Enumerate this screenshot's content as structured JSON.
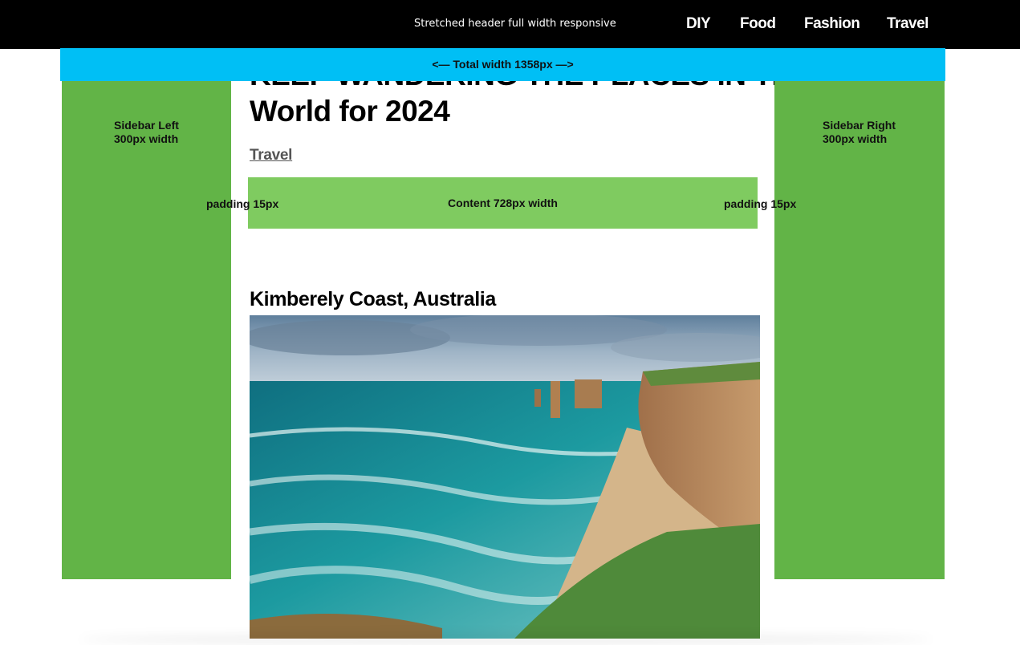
{
  "header": {
    "caption": "Stretched header full width responsive",
    "nav": [
      {
        "label": "DIY"
      },
      {
        "label": "Food"
      },
      {
        "label": "Fashion"
      },
      {
        "label": "Travel"
      }
    ],
    "background": "#000000"
  },
  "width_bar": {
    "label": "<— Total width 1358px —>",
    "color": "#00BFF5"
  },
  "sidebar_left": {
    "label": "Sidebar Left\n300px width",
    "color": "#62B447"
  },
  "sidebar_right": {
    "label": "Sidebar Right\n300px width",
    "color": "#62B447"
  },
  "article": {
    "title_partial": "KEEP WANDERING THE PLACES IN THE",
    "title": "World for 2024",
    "category": "Travel",
    "content_box_label": "Content 728px width",
    "padding_left_label": "padding 15px",
    "padding_right_label": "padding 15px",
    "section_heading": "Kimberely Coast, Australia",
    "image_icon": "coastal-cliffs-photo"
  }
}
